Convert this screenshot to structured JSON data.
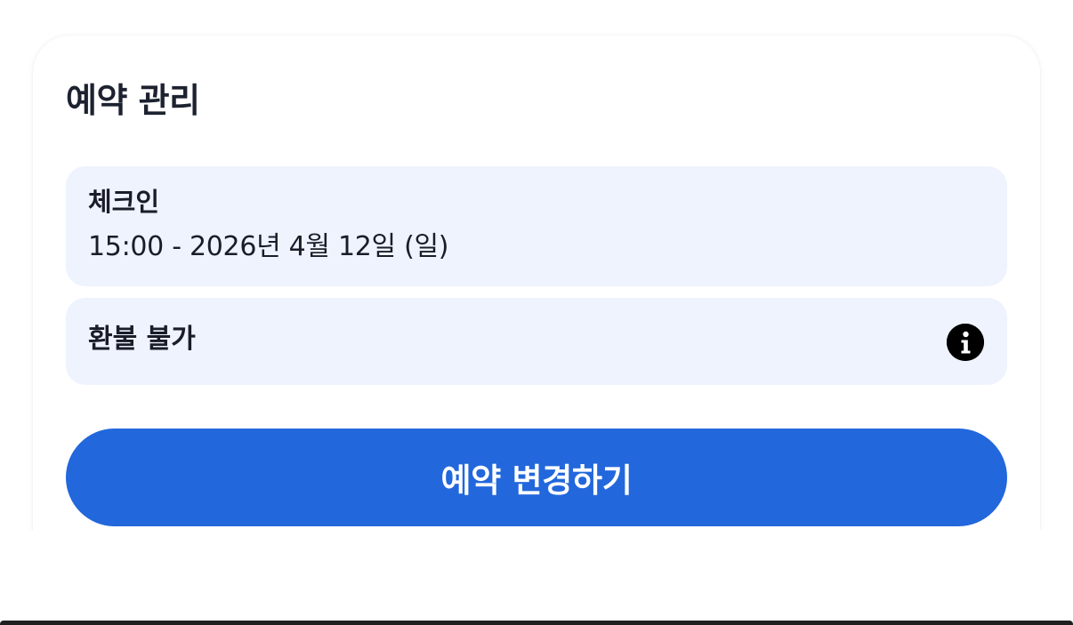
{
  "booking": {
    "title": "예약 관리",
    "checkin": {
      "label": "체크인",
      "value": "15:00 - 2026년 4월 12일 (일)"
    },
    "refund": {
      "label": "환불 불가",
      "icon": "info-icon"
    },
    "change_button_label": "예약 변경하기"
  },
  "colors": {
    "accent": "#2267dc",
    "info_box_bg": "#eef3fe",
    "text": "#1a1d29"
  }
}
